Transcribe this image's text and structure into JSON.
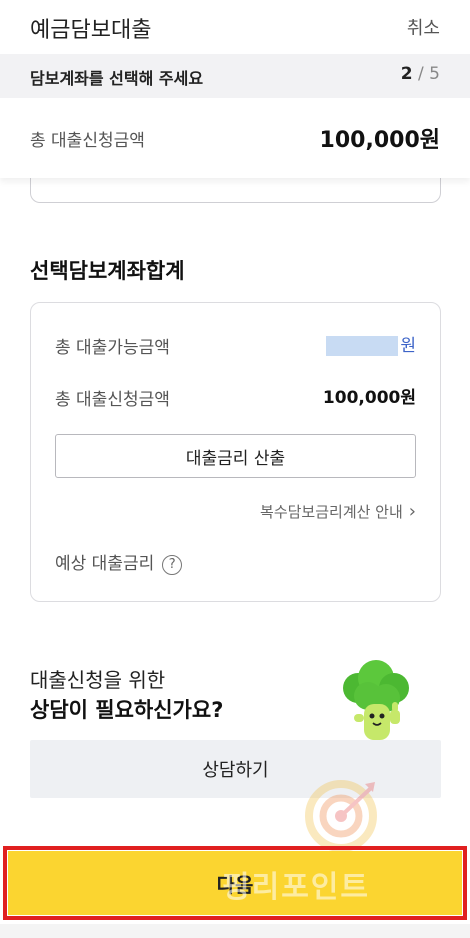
{
  "header": {
    "title": "예금담보대출",
    "cancel_label": "취소"
  },
  "step": {
    "instruction": "담보계좌를 선택해 주세요",
    "current": "2",
    "separator": " / ",
    "total": "5"
  },
  "summary": {
    "label": "총 대출신청금액",
    "amount": "100,000원"
  },
  "selection": {
    "title": "선택담보계좌합계",
    "available_label": "총 대출가능금액",
    "available_unit": "원",
    "apply_label": "총 대출신청금액",
    "apply_value": "100,000원",
    "calc_button_label": "대출금리 산출",
    "guide_link_label": "복수담보금리계산 안내",
    "expected_rate_label": "예상 대출금리"
  },
  "consult": {
    "line1": "대출신청을 위한",
    "line2": "상담이 필요하신가요?",
    "button_label": "상담하기"
  },
  "next": {
    "button_label": "다음"
  },
  "watermark": {
    "text": "핑리포인트"
  },
  "colors": {
    "accent_yellow": "#fbd530",
    "highlight_red": "#e02020",
    "link_blue": "#3d64c8",
    "mascot_green": "#55c23a"
  }
}
